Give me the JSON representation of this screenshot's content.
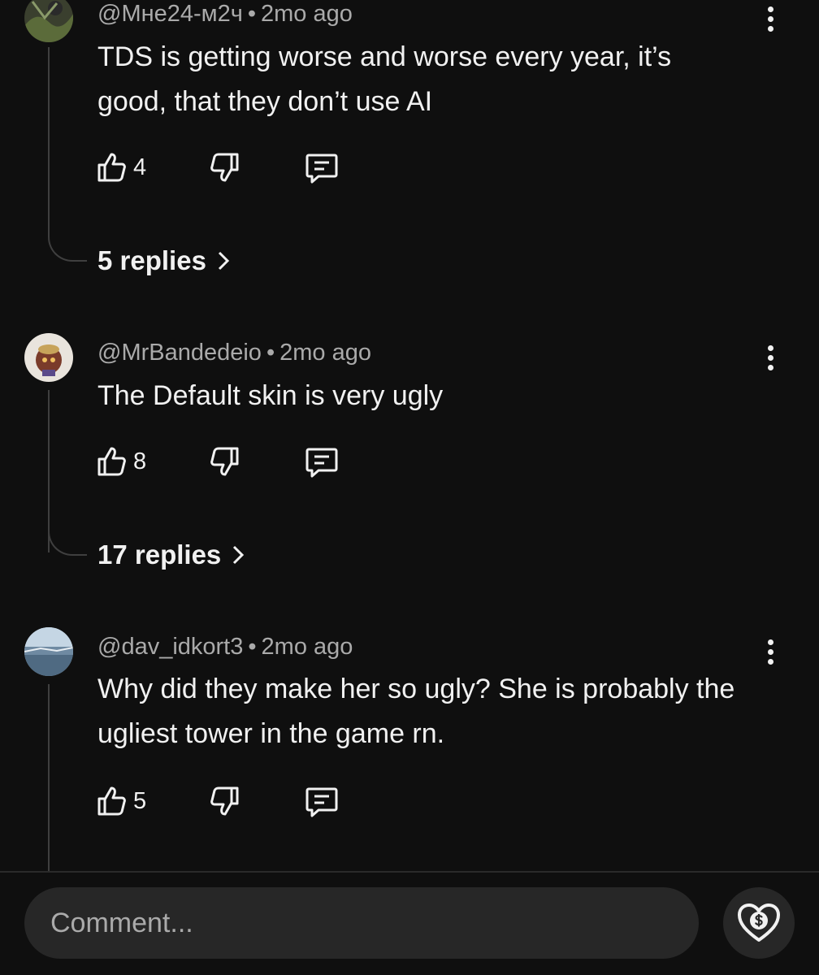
{
  "comments": [
    {
      "author": "@Мне24-м2ч",
      "separator": "•",
      "time": "2mo ago",
      "text": "TDS is getting worse and worse every year, it’s good, that they don’t use AI",
      "likes": "4",
      "replies": "5 replies"
    },
    {
      "author": "@MrBandedeio",
      "separator": "•",
      "time": "2mo ago",
      "text": "The Default skin is very ugly",
      "likes": "8",
      "replies": "17 replies"
    },
    {
      "author": "@dav_idkort3",
      "separator": "•",
      "time": "2mo ago",
      "text": "Why did they make her so ugly? She is probably the ugliest tower in the game rn.",
      "likes": "5"
    }
  ],
  "composer": {
    "placeholder": "Comment..."
  },
  "icons": {
    "like": "thumbs-up-icon",
    "dislike": "thumbs-down-icon",
    "reply": "reply-comment-icon",
    "more": "more-vertical-icon",
    "chevron": "chevron-right-icon",
    "thanks": "super-thanks-heart-dollar-icon"
  },
  "colors": {
    "background": "#0f0f0f",
    "text": "#f1f1f1",
    "secondary_text": "#aaaaaa",
    "input_background": "#272727",
    "thread_line": "#3f3f3f"
  }
}
